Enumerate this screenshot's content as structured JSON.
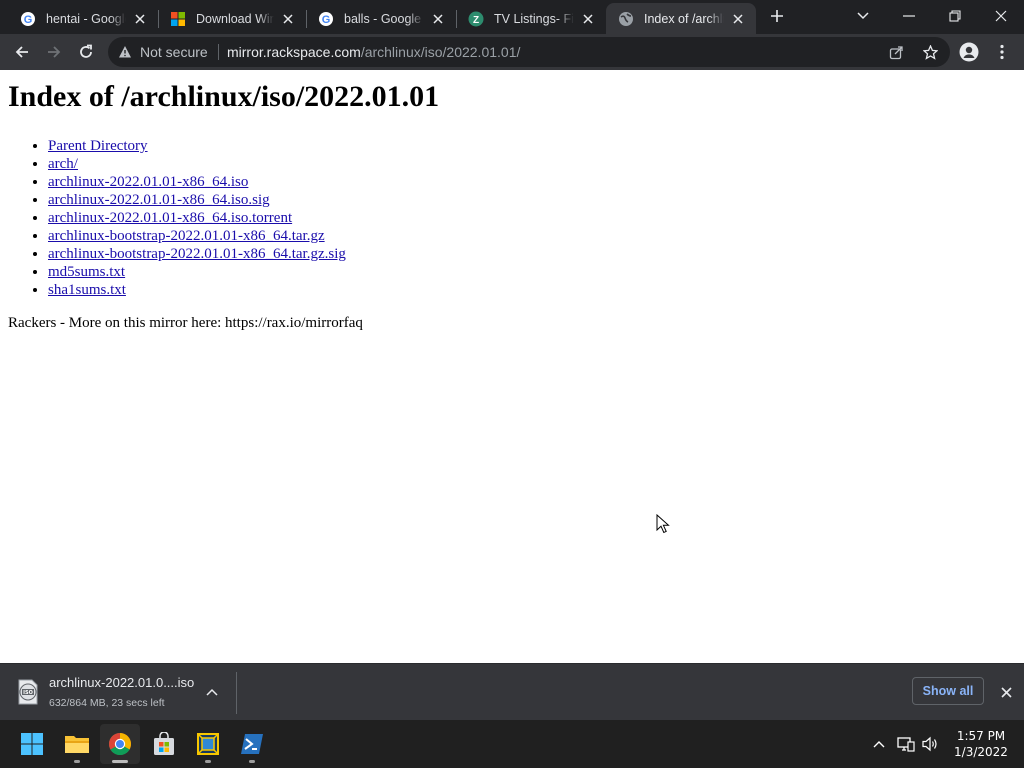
{
  "browser": {
    "tabs": [
      {
        "title": "hentai - Google",
        "favicon": "google-icon",
        "active": false
      },
      {
        "title": "Download Wind",
        "favicon": "windows-logo-icon",
        "active": false
      },
      {
        "title": "balls - Google S",
        "favicon": "google-icon",
        "active": false
      },
      {
        "title": "TV Listings- Fin",
        "favicon": "zap2it-icon",
        "active": false
      },
      {
        "title": "Index of /archlin",
        "favicon": "globe-icon",
        "active": true
      }
    ],
    "omnibox": {
      "security_label": "Not secure",
      "url_host": "mirror.rackspace.com",
      "url_path": "/archlinux/iso/2022.01.01/"
    }
  },
  "page": {
    "heading": "Index of /archlinux/iso/2022.01.01",
    "links": [
      "Parent Directory",
      "arch/",
      "archlinux-2022.01.01-x86_64.iso",
      "archlinux-2022.01.01-x86_64.iso.sig",
      "archlinux-2022.01.01-x86_64.iso.torrent",
      "archlinux-bootstrap-2022.01.01-x86_64.tar.gz",
      "archlinux-bootstrap-2022.01.01-x86_64.tar.gz.sig",
      "md5sums.txt",
      "sha1sums.txt"
    ],
    "footer_note": "Rackers - More on this mirror here: https://rax.io/mirrorfaq"
  },
  "download_shelf": {
    "file_name": "archlinux-2022.01.0....iso",
    "status": "632/864 MB, 23 secs left",
    "icon_label": "ISO",
    "show_all_label": "Show all"
  },
  "taskbar": {
    "apps": [
      "start-icon",
      "file-explorer-icon",
      "chrome-icon",
      "microsoft-store-icon",
      "virtualbox-icon",
      "powershell-icon"
    ],
    "clock_time": "1:57 PM",
    "clock_date": "1/3/2022"
  },
  "colors": {
    "link": "#1a0dab",
    "accent_blue": "#8ab4f8",
    "tab_strip": "#202124",
    "toolbar": "#35363a"
  }
}
